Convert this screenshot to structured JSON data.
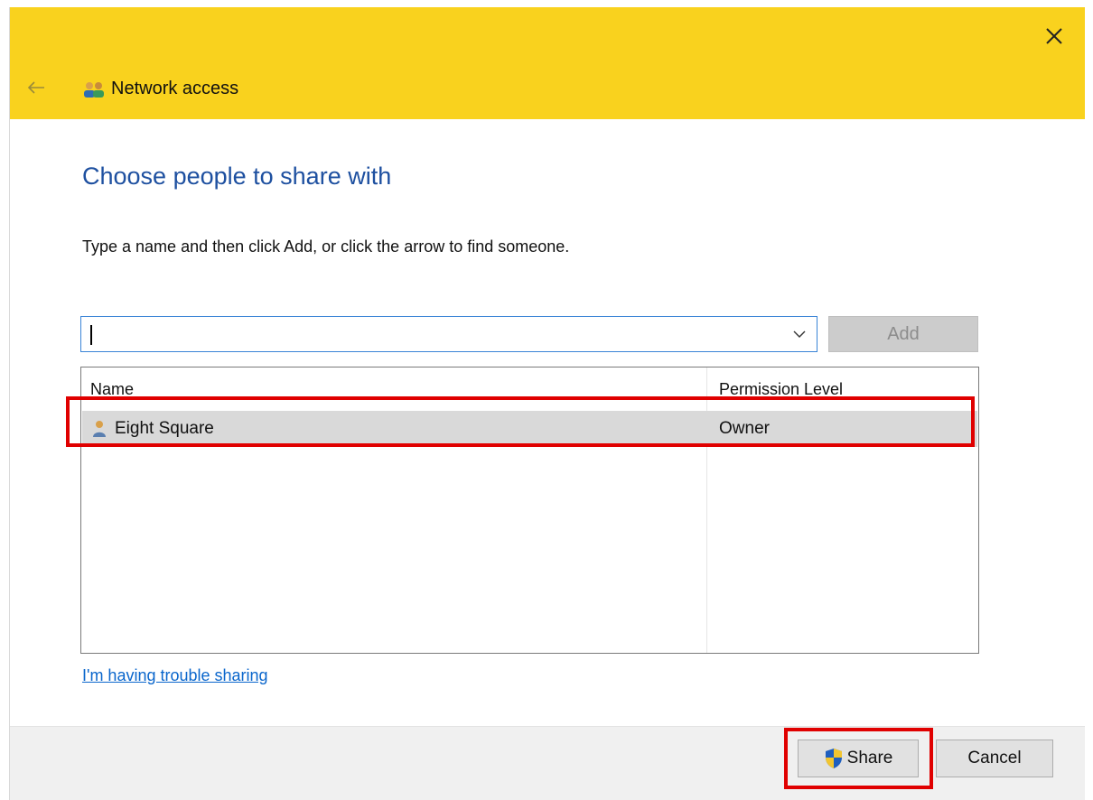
{
  "window": {
    "nav_title": "Network access",
    "nav_icon": "network-users-icon"
  },
  "dialog": {
    "heading": "Choose people to share with",
    "instruction": "Type a name and then click Add, or click the arrow to find someone."
  },
  "combo": {
    "value": "",
    "placeholder": ""
  },
  "add_button": {
    "label": "Add",
    "enabled": false
  },
  "list": {
    "columns": [
      "Name",
      "Permission Level"
    ],
    "rows": [
      {
        "name": "Eight Square",
        "permission": "Owner",
        "icon": "user-icon",
        "selected": true
      }
    ]
  },
  "link": {
    "trouble": "I'm having trouble sharing"
  },
  "footer": {
    "share_label": "Share",
    "share_icon": "uac-shield-icon",
    "cancel_label": "Cancel"
  },
  "colors": {
    "titlebar": "#f9d21e",
    "heading": "#1e50a0",
    "link": "#0a66cc",
    "highlight": "#e00000",
    "selected_row": "#d9d9d9"
  }
}
